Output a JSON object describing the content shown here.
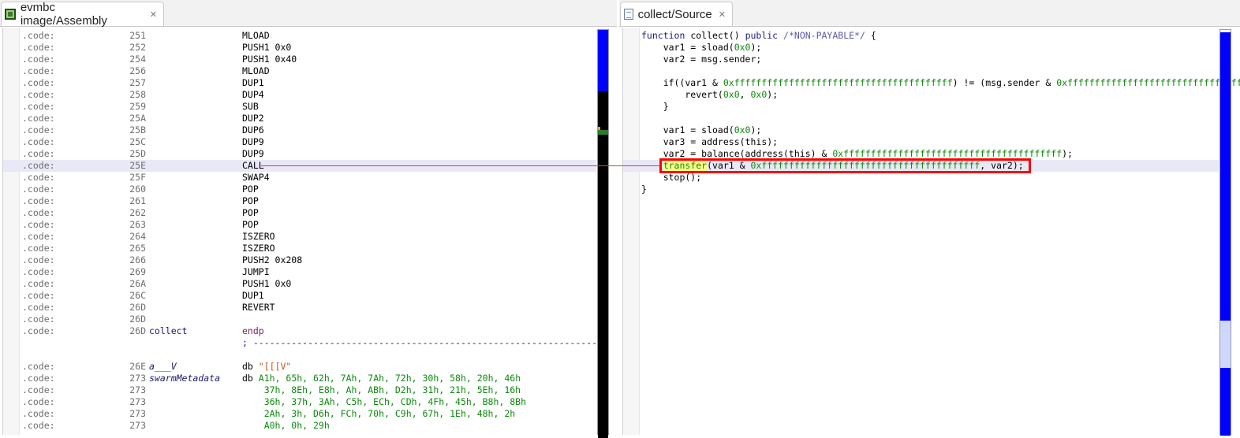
{
  "left_panel": {
    "tab_title": "evmbc image/Assembly",
    "tab_icon": "assembly-chip-icon",
    "lines": [
      {
        "seg": ".code:",
        "addr": "251",
        "name": "",
        "op": "MLOAD"
      },
      {
        "seg": ".code:",
        "addr": "252",
        "name": "",
        "op": "PUSH1 0x0"
      },
      {
        "seg": ".code:",
        "addr": "254",
        "name": "",
        "op": "PUSH1 0x40"
      },
      {
        "seg": ".code:",
        "addr": "256",
        "name": "",
        "op": "MLOAD"
      },
      {
        "seg": ".code:",
        "addr": "257",
        "name": "",
        "op": "DUP1"
      },
      {
        "seg": ".code:",
        "addr": "258",
        "name": "",
        "op": "DUP4"
      },
      {
        "seg": ".code:",
        "addr": "259",
        "name": "",
        "op": "SUB"
      },
      {
        "seg": ".code:",
        "addr": "25A",
        "name": "",
        "op": "DUP2"
      },
      {
        "seg": ".code:",
        "addr": "25B",
        "name": "",
        "op": "DUP6"
      },
      {
        "seg": ".code:",
        "addr": "25C",
        "name": "",
        "op": "DUP9"
      },
      {
        "seg": ".code:",
        "addr": "25D",
        "name": "",
        "op": "DUP9"
      },
      {
        "seg": ".code:",
        "addr": "25E",
        "name": "",
        "op": "CALL"
      },
      {
        "seg": ".code:",
        "addr": "25F",
        "name": "",
        "op": "SWAP4"
      },
      {
        "seg": ".code:",
        "addr": "260",
        "name": "",
        "op": "POP"
      },
      {
        "seg": ".code:",
        "addr": "261",
        "name": "",
        "op": "POP"
      },
      {
        "seg": ".code:",
        "addr": "262",
        "name": "",
        "op": "POP"
      },
      {
        "seg": ".code:",
        "addr": "263",
        "name": "",
        "op": "POP"
      },
      {
        "seg": ".code:",
        "addr": "264",
        "name": "",
        "op": "ISZERO"
      },
      {
        "seg": ".code:",
        "addr": "265",
        "name": "",
        "op": "ISZERO"
      },
      {
        "seg": ".code:",
        "addr": "266",
        "name": "",
        "op": "PUSH2 0x208"
      },
      {
        "seg": ".code:",
        "addr": "269",
        "name": "",
        "op": "JUMPI"
      },
      {
        "seg": ".code:",
        "addr": "26A",
        "name": "",
        "op": "PUSH1 0x0"
      },
      {
        "seg": ".code:",
        "addr": "26C",
        "name": "",
        "op": "DUP1"
      },
      {
        "seg": ".code:",
        "addr": "26D",
        "name": "",
        "op": "REVERT"
      },
      {
        "seg": ".code:",
        "addr": "26D",
        "name": "",
        "op": ""
      },
      {
        "seg": ".code:",
        "addr": "26D",
        "name": "collect",
        "op": "endp"
      },
      {
        "seg": "",
        "addr": "",
        "name": "",
        "op": "; ----------------------------------------------------------------"
      },
      {
        "seg": "",
        "addr": "",
        "name": "",
        "op": ""
      },
      {
        "seg": ".code:",
        "addr": "26E",
        "name": "a___V",
        "op_kw": "db",
        "op_str": "\"[[[V\""
      },
      {
        "seg": ".code:",
        "addr": "273",
        "name": "swarmMetadata",
        "op_kw": "db",
        "op_data": "A1h, 65h, 62h, 7Ah, 7Ah, 72h, 30h, 58h, 20h, 46h"
      },
      {
        "seg": ".code:",
        "addr": "273",
        "name": "",
        "op_data": "    37h, 8Eh, E8h, Ah, ABh, D2h, 31h, 21h, 5Eh, 16h"
      },
      {
        "seg": ".code:",
        "addr": "273",
        "name": "",
        "op_data": "    36h, 37h, 3Ah, C5h, ECh, CDh, 4Fh, 45h, B8h, 8Bh"
      },
      {
        "seg": ".code:",
        "addr": "273",
        "name": "",
        "op_data": "    2Ah, 3h, D6h, FCh, 70h, C9h, 67h, 1Eh, 48h, 2h"
      },
      {
        "seg": ".code:",
        "addr": "273",
        "name": "",
        "op_data": "    A0h, 0h, 29h"
      }
    ],
    "highlighted_index": 11
  },
  "right_panel": {
    "tab_title": "collect/Source",
    "tab_icon": "source-file-icon",
    "lines": [
      "function collect() public /*NON-PAYABLE*/ {",
      "    var1 = sload(0x0);",
      "    var2 = msg.sender;",
      "",
      "    if((var1 & 0xffffffffffffffffffffffffffffffffffffffff) != (msg.sender & 0xffffffffffffffffffffffffffffffffffffffff",
      "        revert(0x0, 0x0);",
      "    }",
      "",
      "    var1 = sload(0x0);",
      "    var3 = address(this);",
      "    var2 = balance(address(this) & 0xffffffffffffffffffffffffffffffffffffffff);",
      "    transfer(var1 & 0xffffffffffffffffffffffffffffffffffffffff, var2);",
      "    stop();",
      "}"
    ],
    "highlighted_index": 11
  }
}
